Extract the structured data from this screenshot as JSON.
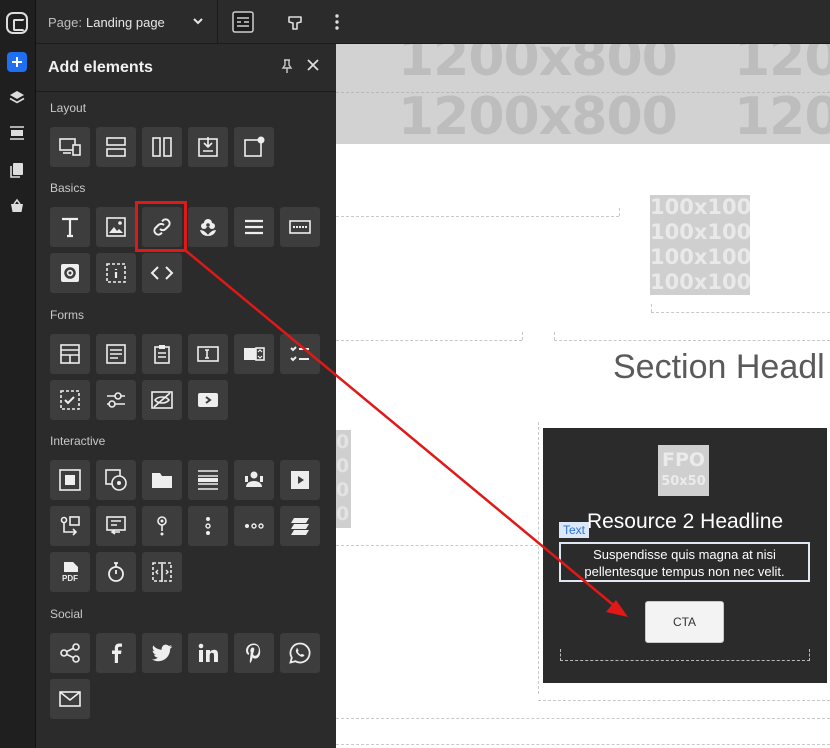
{
  "topbar": {
    "page_label": "Page:",
    "page_value": "Landing page"
  },
  "panel": {
    "title": "Add elements",
    "sections": {
      "layout": "Layout",
      "basics": "Basics",
      "forms": "Forms",
      "interactive": "Interactive",
      "social": "Social"
    }
  },
  "canvas": {
    "banner_placeholder": "1200x800",
    "banner_placeholder_cut": "120",
    "image_placeholder_lines": [
      "100x100",
      "100x100",
      "100x100",
      "100x100"
    ],
    "section_headline": "Section Headl",
    "side_placeholder_lines": [
      "0",
      "0",
      "0",
      "0"
    ],
    "resource_card": {
      "fpo_top": "FPO",
      "fpo_bottom": "50x50",
      "headline": "Resource 2 Headline",
      "text_tag": "Text",
      "body": "Suspendisse quis magna at nisi pellentesque tempus non nec velit.",
      "cta": "CTA"
    }
  },
  "colors": {
    "accent": "#1f6ff0",
    "highlight": "#e01818",
    "panel_bg": "#2b2b2b",
    "tile_bg": "#3d3d3d"
  }
}
